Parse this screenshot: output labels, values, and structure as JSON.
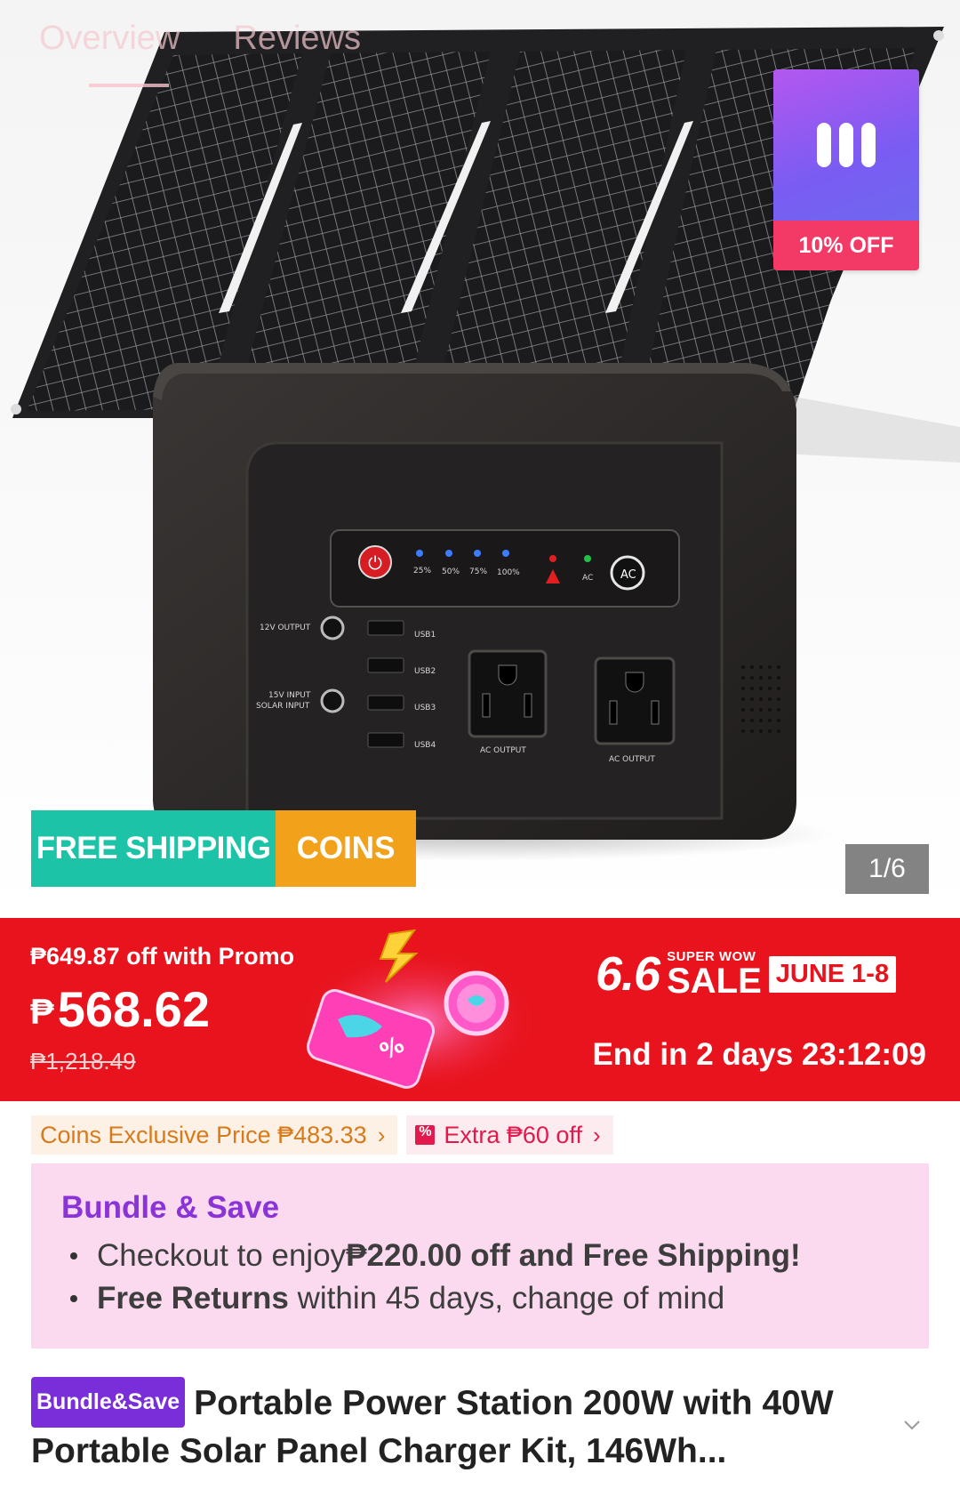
{
  "top_tabs": [
    "Overview",
    "Reviews"
  ],
  "hero": {
    "discount_badge": {
      "label": "10% OFF",
      "icon": "bars-icon"
    },
    "shipping_badge": {
      "free_label": "FREE SHIPPING",
      "coins_label": "COINS"
    },
    "image_counter": "1/6",
    "device_labels": {
      "led_levels": [
        "25%",
        "50%",
        "75%",
        "100%"
      ],
      "ac": "AC",
      "ac_button": "AC",
      "out12": "12V OUTPUT",
      "in15a": "15V INPUT",
      "in15b": "SOLAR INPUT",
      "usb": [
        "USB1",
        "USB2",
        "USB3",
        "USB4"
      ],
      "ac_output": "AC OUTPUT"
    }
  },
  "price": {
    "promo_line": "₱649.87 off with Promo",
    "currency": "₱",
    "current": "568.62",
    "original": "₱1,218.49"
  },
  "campaign": {
    "sale_number": "6.6",
    "super_wow": "SUPER WOW",
    "sale_word": "SALE",
    "dates": "JUNE 1-8",
    "countdown": "End in 2 days 23:12:09"
  },
  "chips": {
    "coins_exclusive": "Coins Exclusive Price ₱483.33",
    "extra_off": "Extra ₱60 off"
  },
  "bundle": {
    "title": "Bundle & Save",
    "line1_prefix": "Checkout to enjoy ",
    "line1_bold": "₱220.00 off and Free Shipping!",
    "line2_bold": "Free Returns",
    "line2_rest": " within 45 days, change of mind"
  },
  "product": {
    "tag": "Bundle&Save",
    "title": "Portable Power Station 200W with 40W Portable Solar Panel Charger Kit, 146Wh..."
  },
  "colors": {
    "price_banner": "#e8131c",
    "free_shipping": "#1cc3a6",
    "coins": "#f2a11b",
    "bundle_bg": "#fbd9ee",
    "bundle_title": "#8a33d6"
  }
}
